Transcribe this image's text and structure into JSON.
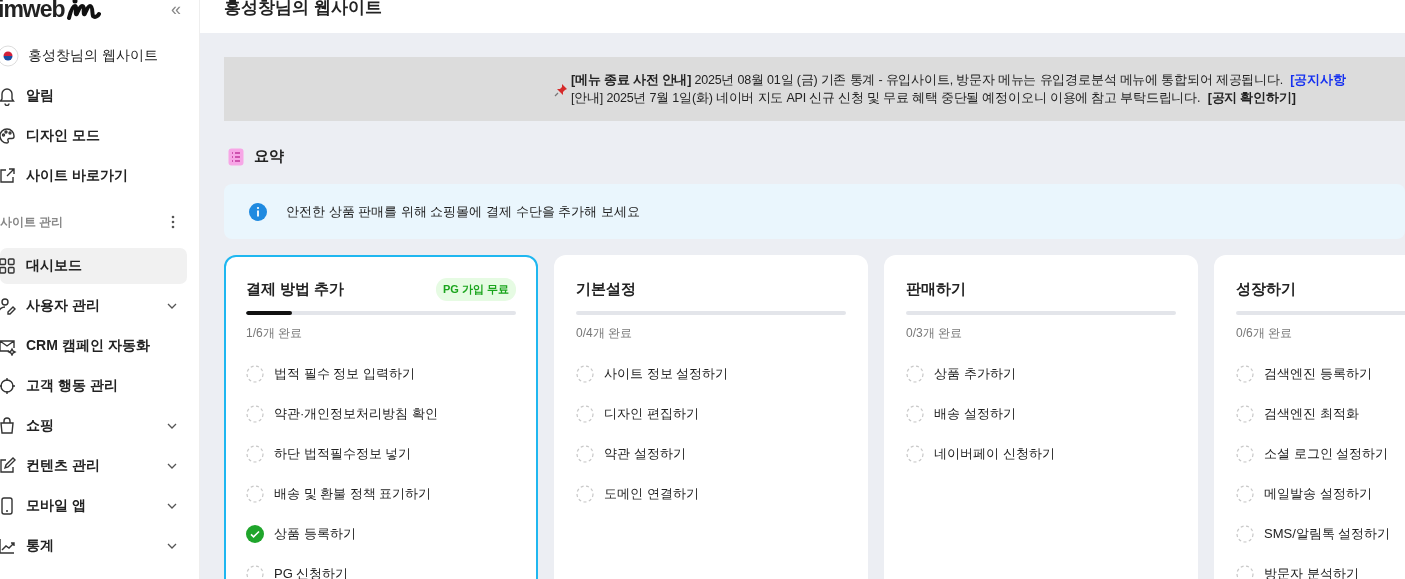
{
  "sidebar": {
    "logo": "imweb",
    "collapse": "«",
    "site_name": "홍성창님의 웹사이트",
    "top_items": [
      {
        "label": "알림"
      },
      {
        "label": "디자인 모드"
      },
      {
        "label": "사이트 바로가기"
      }
    ],
    "section_title": "사이트 관리",
    "items": [
      {
        "label": "대시보드",
        "selected": true,
        "expandable": false
      },
      {
        "label": "사용자 관리",
        "selected": false,
        "expandable": true
      },
      {
        "label": "CRM 캠페인 자동화",
        "selected": false,
        "expandable": false
      },
      {
        "label": "고객 행동 관리",
        "selected": false,
        "expandable": false
      },
      {
        "label": "쇼핑",
        "selected": false,
        "expandable": true
      },
      {
        "label": "컨텐츠 관리",
        "selected": false,
        "expandable": true
      },
      {
        "label": "모바일 앱",
        "selected": false,
        "expandable": true
      },
      {
        "label": "통계",
        "selected": false,
        "expandable": true
      }
    ]
  },
  "header": {
    "title": "홍성창님의 웹사이트"
  },
  "notice": {
    "lines": [
      {
        "text": "**[메뉴 종료 사전 안내]** 2025년 08월 01일 (금) 기존 통계 - 유입사이트, 방문자 메뉴는 유입경로분석 메뉴에 통합되어 제공됩니다.",
        "link": "[공지사항",
        "color": "#1530f0"
      },
      {
        "text": "[안내] 2025년 7월 1일(화) 네이버 지도 API 신규 신청 및 무료 혜택 중단될 예정이오니 이용에 참고 부탁드립니다.",
        "link": "[공지 확인하기]",
        "color": "#222222"
      }
    ]
  },
  "summary": {
    "title": "요약",
    "info": "안전한 상품 판매를 위해 쇼핑몰에 결제 수단을 추가해 보세요"
  },
  "cards": [
    {
      "title": "결제 방법 추가",
      "badge": "PG 가입 무료",
      "selected": true,
      "level": 0.17,
      "progress": "1/6개 완료",
      "tasks": [
        {
          "label": "법적 필수 정보 입력하기",
          "checked": false
        },
        {
          "label": "약관·개인정보처리방침 확인",
          "checked": false
        },
        {
          "label": "하단 법적필수정보 넣기",
          "checked": false
        },
        {
          "label": "배송 및 환불 정책 표기하기",
          "checked": false
        },
        {
          "label": "상품 등록하기",
          "checked": true
        },
        {
          "label": "PG 신청하기",
          "checked": false
        }
      ]
    },
    {
      "title": "기본설정",
      "selected": false,
      "level": 0,
      "progress": "0/4개 완료",
      "tasks": [
        {
          "label": "사이트 정보 설정하기",
          "checked": false
        },
        {
          "label": "디자인 편집하기",
          "checked": false
        },
        {
          "label": "약관 설정하기",
          "checked": false
        },
        {
          "label": "도메인 연결하기",
          "checked": false
        }
      ]
    },
    {
      "title": "판매하기",
      "selected": false,
      "level": 0,
      "progress": "0/3개 완료",
      "tasks": [
        {
          "label": "상품 추가하기",
          "checked": false
        },
        {
          "label": "배송 설정하기",
          "checked": false
        },
        {
          "label": "네이버페이 신청하기",
          "checked": false
        }
      ]
    },
    {
      "title": "성장하기",
      "selected": false,
      "level": 0,
      "progress": "0/6개 완료",
      "tasks": [
        {
          "label": "검색엔진 등록하기",
          "checked": false
        },
        {
          "label": "검색엔진 최적화",
          "checked": false
        },
        {
          "label": "소셜 로그인 설정하기",
          "checked": false
        },
        {
          "label": "메일발송 설정하기",
          "checked": false
        },
        {
          "label": "SMS/알림톡 설정하기",
          "checked": false
        },
        {
          "label": "방문자 분석하기",
          "checked": false
        }
      ]
    }
  ]
}
